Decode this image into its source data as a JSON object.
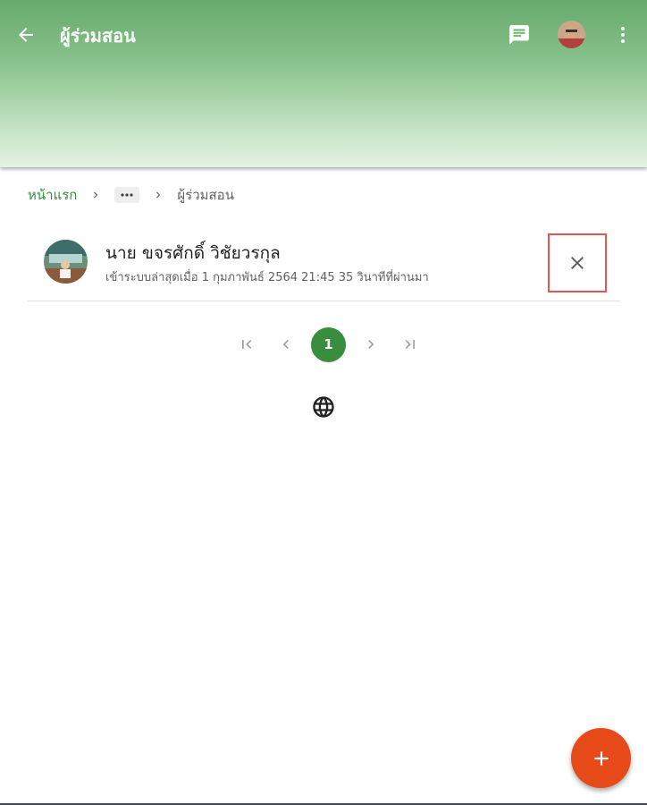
{
  "header": {
    "title": "ผู้ร่วมสอน",
    "icons": [
      "arrow-back-icon",
      "chat-icon",
      "avatar",
      "more-vert-icon"
    ]
  },
  "breadcrumb": {
    "home": "หน้าแรก",
    "ellipsis": "···",
    "current": "ผู้ร่วมสอน"
  },
  "teacher": {
    "name": "นาย ขจรศักดิ์ วิชัยวรกุล",
    "last_login": "เข้าระบบล่าสุดเมื่อ 1 กุมภาพันธ์ 2564 21:45 35 วินาทีที่ผ่านมา"
  },
  "pagination": {
    "current_page": "1"
  },
  "colors": {
    "accent": "#388e3c",
    "fab": "#e64a19",
    "highlight": "#e05555"
  }
}
